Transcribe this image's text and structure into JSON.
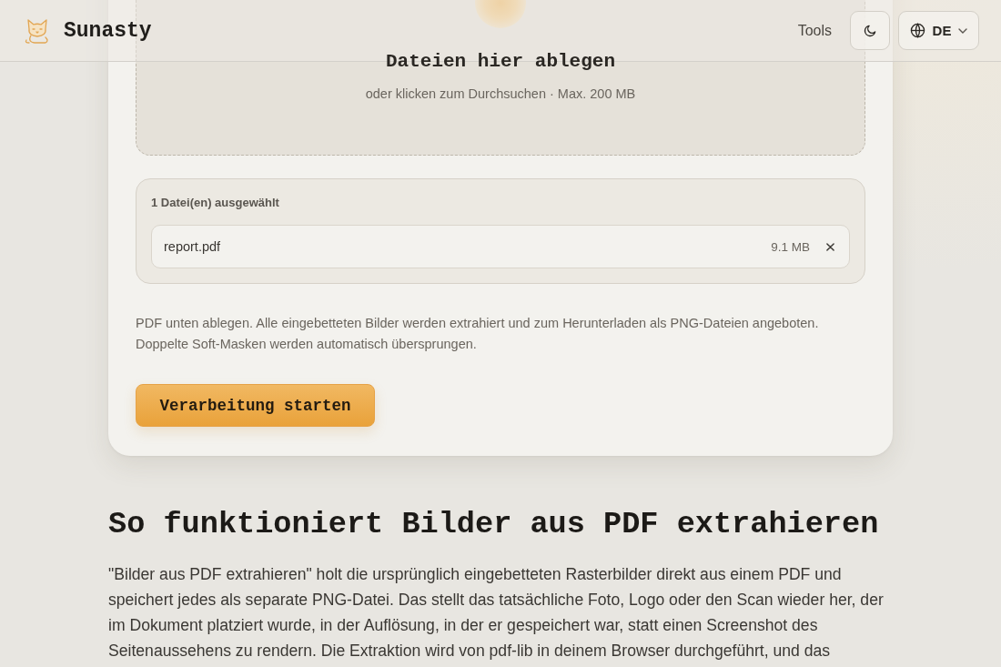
{
  "header": {
    "brand": "Sunasty",
    "nav": [
      {
        "label": "Tools"
      }
    ],
    "language": {
      "label": "DE"
    }
  },
  "dropzone": {
    "title": "Dateien hier ablegen",
    "hint": "oder klicken zum Durchsuchen · Max. 200 MB"
  },
  "selection": {
    "title": "1 Datei(en) ausgewählt",
    "files": [
      {
        "name": "report.pdf",
        "size": "9.1 MB"
      }
    ]
  },
  "description": "PDF unten ablegen. Alle eingebetteten Bilder werden extrahiert und zum Herunterladen als PNG-Dateien angeboten. Doppelte Soft-Masken werden automatisch übersprungen.",
  "start_button": "Verarbeitung starten",
  "article": {
    "heading": "So funktioniert Bilder aus PDF extrahieren",
    "paragraph": "\"Bilder aus PDF extrahieren\" holt die ursprünglich eingebetteten Rasterbilder direkt aus einem PDF und speichert jedes als separate PNG-Datei. Das stellt das tatsächliche Foto, Logo oder den Scan wieder her, der im Dokument platziert wurde, in der Auflösung, in der er gespeichert war, statt einen Screenshot des Seitenaussehens zu rendern. Die Extraktion wird von pdf-lib in deinem Browser durchgeführt, und das"
  }
}
